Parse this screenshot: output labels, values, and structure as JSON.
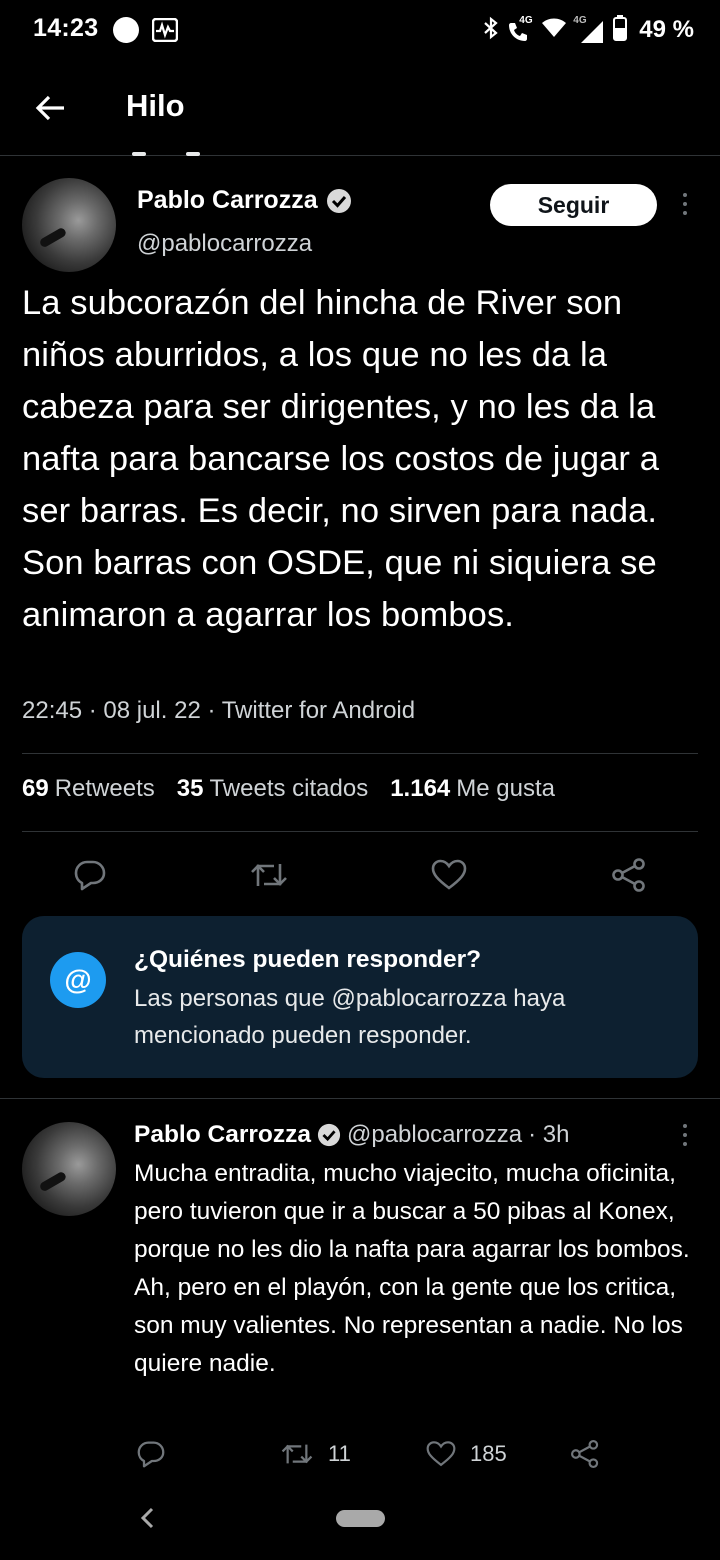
{
  "status_bar": {
    "time": "14:23",
    "network_1": "4G",
    "network_2": "4G",
    "battery": "49 %",
    "icons": [
      "circle-dot-icon",
      "activity-icon",
      "bluetooth-icon",
      "call-icon",
      "wifi-icon",
      "signal-icon",
      "battery-icon"
    ]
  },
  "header": {
    "title": "Hilo",
    "back_icon": "arrow-left-icon"
  },
  "main_tweet": {
    "author_name": "Pablo Carrozza",
    "handle": "@pablocarrozza",
    "follow_label": "Seguir",
    "text": "La subcorazón del hincha de River son niños aburridos, a los que no les da la cabeza para ser dirigentes, y no les da la nafta para bancarse los costos de jugar a ser barras. Es decir, no sirven para nada. Son barras con OSDE, que ni siquiera se animaron a agarrar los bombos.",
    "meta": "22:45 · 08 jul. 22 · Twitter for Android",
    "stats": {
      "retweets_count": "69",
      "retweets_label": "Retweets",
      "quotes_count": "35",
      "quotes_label": "Tweets citados",
      "likes_count": "1.164",
      "likes_label": "Me gusta"
    },
    "action_icons": [
      "reply-icon",
      "retweet-icon",
      "like-icon",
      "share-icon"
    ]
  },
  "who_can_reply": {
    "icon_text": "@",
    "title": "¿Quiénes pueden responder?",
    "body": "Las personas que @pablocarrozza haya mencionado pueden responder."
  },
  "reply_tweet": {
    "author_name": "Pablo Carrozza",
    "handle": "@pablocarrozza",
    "time": "· 3h",
    "text": "Mucha entradita, mucho viajecito, mucha oficinita, pero tuvieron que ir a buscar a 50 pibas al Konex, porque no les dio la nafta para agarrar los bombos. Ah, pero en el playón, con la gente que los critica, son muy valientes. No representan a nadie. No los quiere nadie.",
    "retweets": "11",
    "likes": "185"
  },
  "colors": {
    "background": "#000000",
    "accent": "#1d9bf0",
    "card_bg": "#0d2030",
    "divider": "#2f3336",
    "muted_text": "#cfd3d6"
  }
}
